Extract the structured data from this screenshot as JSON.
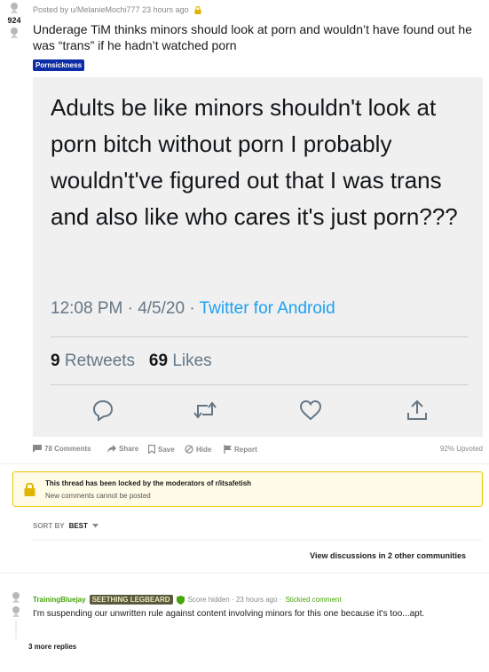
{
  "post": {
    "score": "924",
    "meta": "Posted by u/MelanieMochi777 23 hours ago",
    "title": "Underage TiM thinks minors should look at porn and wouldn’t have found out he was “trans” if he hadn’t watched porn",
    "flair": "Pornsickness"
  },
  "tweet": {
    "text": "Adults be like minors shouldn't look at porn bitch without porn I probably wouldn't've figured out that I was trans and also like who cares it's just porn???",
    "time": "12:08 PM · 4/5/20 · ",
    "source": "Twitter for Android",
    "retweets_count": "9",
    "retweets_label": " Retweets",
    "likes_count": "69",
    "likes_label": " Likes",
    "action_icons": [
      "reply-icon",
      "retweet-icon",
      "like-icon",
      "share-icon"
    ]
  },
  "actions": {
    "comments": "78 Comments",
    "share": "Share",
    "save": "Save",
    "hide": "Hide",
    "report": "Report",
    "upvoted": "92% Upvoted"
  },
  "locked": {
    "line1": "This thread has been locked by the moderators of r/itsafetish",
    "line2": "New comments cannot be posted"
  },
  "sort": {
    "label": "SORT BY",
    "value": "BEST"
  },
  "other_discussions": "View discussions in 2 other communities",
  "comment": {
    "user": "TrainingBluejay",
    "flair": "SEETHING LEGBEARD",
    "meta": "Score hidden · 23 hours ago ·",
    "stickied": "Stickied comment",
    "body": "I'm suspending our unwritten rule against content involving minors for this one because it's too...apt.",
    "more": "3 more replies"
  },
  "colors": {
    "flair_bg": "#0d2da8",
    "tweet_link": "#1da1f2",
    "commenter": "#46a508",
    "lock_bg": "#fffbe6",
    "lock_border": "#e8c800"
  }
}
